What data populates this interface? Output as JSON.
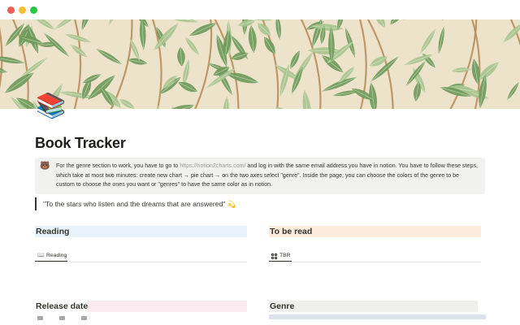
{
  "window": {
    "controls": [
      "close",
      "minimize",
      "zoom"
    ]
  },
  "cover": {
    "description_icon": "leaf-pattern-cover",
    "colors": {
      "background": "#ede3cb",
      "leaf_dark": "#6f9a5c",
      "leaf_light": "#a8c48f",
      "stem": "#b58a58"
    }
  },
  "page": {
    "icon": "📚",
    "title": "Book Tracker"
  },
  "callout": {
    "icon": "🐻",
    "text_before": "For the genre section to work, you have to go to ",
    "link": "https://notion2charts.com/",
    "text_after": " and log in with the same email address you have in notion. You have to follow these steps, which take at most two minutes: create new chart → pie chart → on the two axes select \"genre\". Inside the page, you can choose the colors of the genre to be custom to choose the ones you want or \"genres\" to have the same color as in notion."
  },
  "quote": {
    "text": "\"To the stars who listen and the dreams that are answered\" 💫"
  },
  "sections": {
    "reading": {
      "title": "Reading",
      "tab_label": "Reading",
      "tab_icon": "book-icon",
      "color": "#e7f3f8"
    },
    "to_be_read": {
      "title": "To be read",
      "tab_label": "TBR",
      "tab_icon": "gallery-icon",
      "color": "#fbecdd"
    },
    "release_date": {
      "title": "Release date",
      "color": "#fbeaef"
    },
    "genre": {
      "title": "Genre",
      "color": "#efefee"
    }
  }
}
